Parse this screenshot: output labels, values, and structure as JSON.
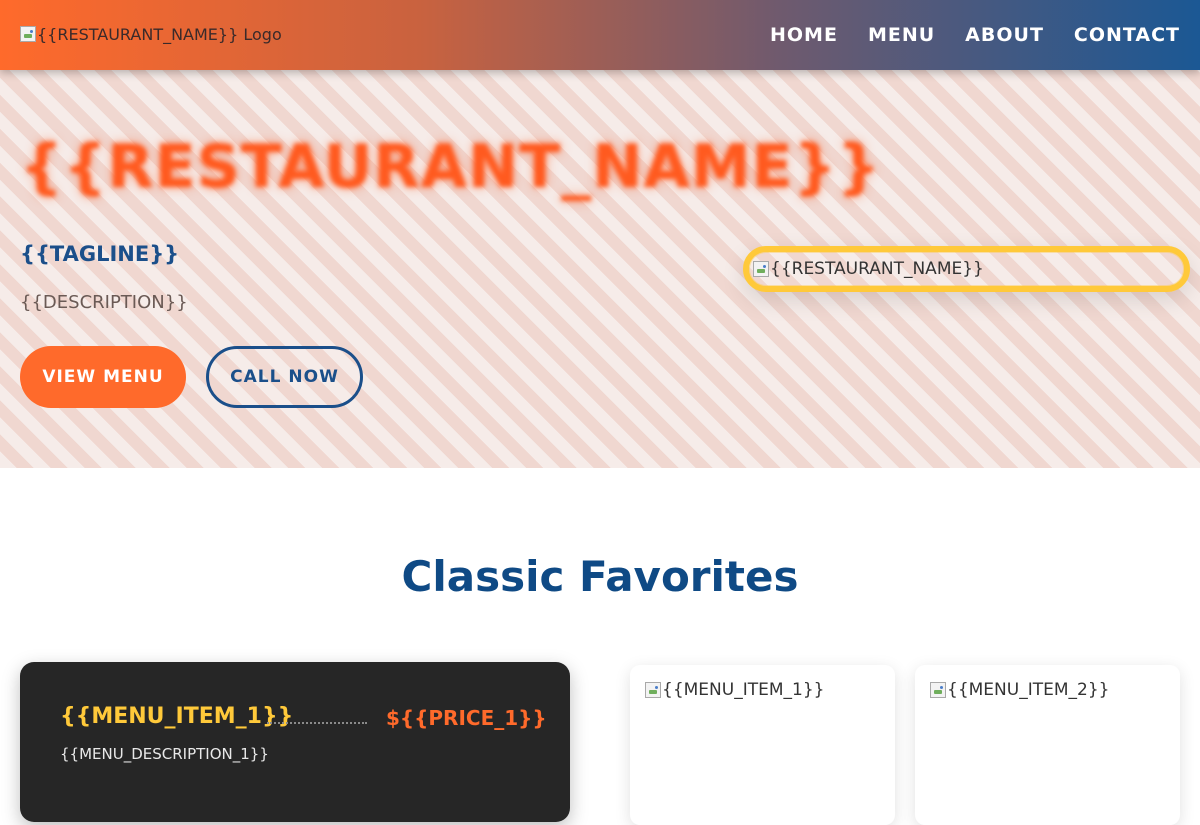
{
  "header": {
    "logo_alt": "{{RESTAURANT_NAME}} Logo",
    "nav": [
      "HOME",
      "MENU",
      "ABOUT",
      "CONTACT"
    ],
    "gradient_start": "#ff6a2b",
    "gradient_end": "#1b5894"
  },
  "hero": {
    "title": "{{RESTAURANT_NAME}}",
    "tagline": "{{TAGLINE}}",
    "description": "{{DESCRIPTION}}",
    "primary_button": "VIEW MENU",
    "secondary_button": "CALL NOW",
    "image_alt": "{{RESTAURANT_NAME}}"
  },
  "section": {
    "title": "Classic Favorites"
  },
  "featured_item": {
    "name": "{{MENU_ITEM_1}}",
    "price": "${{PRICE_1}}",
    "description": "{{MENU_DESCRIPTION_1}}"
  },
  "cards": [
    {
      "image_alt": "{{MENU_ITEM_1}}"
    },
    {
      "image_alt": "{{MENU_ITEM_2}}"
    }
  ],
  "colors": {
    "accent_orange": "#ff6a2b",
    "brand_blue": "#1b4f8a",
    "highlight_yellow": "#ffc93a"
  }
}
